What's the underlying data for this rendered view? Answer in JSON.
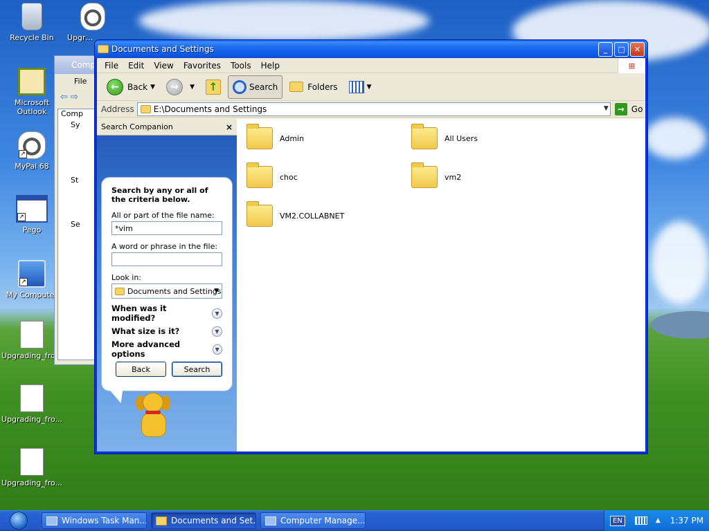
{
  "desktop": {
    "icons": [
      {
        "label": "Recycle Bin"
      },
      {
        "label": "Upgradi"
      },
      {
        "label": "Microsoft Outlook"
      },
      {
        "label": "MyPal 68"
      },
      {
        "label": "Pego"
      },
      {
        "label": "My Computer"
      },
      {
        "label": "Upgrading_fro..."
      },
      {
        "label": "Upgrading_fro..."
      },
      {
        "label": "Upgrading_fro..."
      }
    ]
  },
  "bg_window": {
    "title": "Comp",
    "menu_file": "File",
    "tree": [
      "Comp",
      "Sy",
      "",
      "",
      "",
      "",
      "",
      "St",
      "",
      "",
      "",
      "Se"
    ]
  },
  "window": {
    "title": "Documents and Settings",
    "menu": [
      "File",
      "Edit",
      "View",
      "Favorites",
      "Tools",
      "Help"
    ],
    "toolbar": {
      "back": "Back",
      "search": "Search",
      "folders": "Folders"
    },
    "address": {
      "label": "Address",
      "value": "E:\\Documents and Settings",
      "go": "Go"
    },
    "companion": {
      "header": "Search Companion",
      "close": "×",
      "hint": "Search by any or all of the criteria below.",
      "filename_label": "All or part of the file name:",
      "filename_value": "*vim",
      "phrase_label": "A word or phrase in the file:",
      "phrase_value": "",
      "lookin_label": "Look in:",
      "lookin_value": "Documents and Settings",
      "options": [
        "When was it modified?",
        "What size is it?",
        "More advanced options"
      ],
      "back_button": "Back",
      "search_button": "Search"
    },
    "files": [
      "Admin",
      "All Users",
      "choc",
      "vm2",
      "VM2.COLLABNET"
    ]
  },
  "taskbar": {
    "tasks": [
      "Windows Task Man...",
      "Documents and Set...",
      "Computer Manage..."
    ],
    "lang": "EN",
    "clock": "1:37 PM"
  }
}
